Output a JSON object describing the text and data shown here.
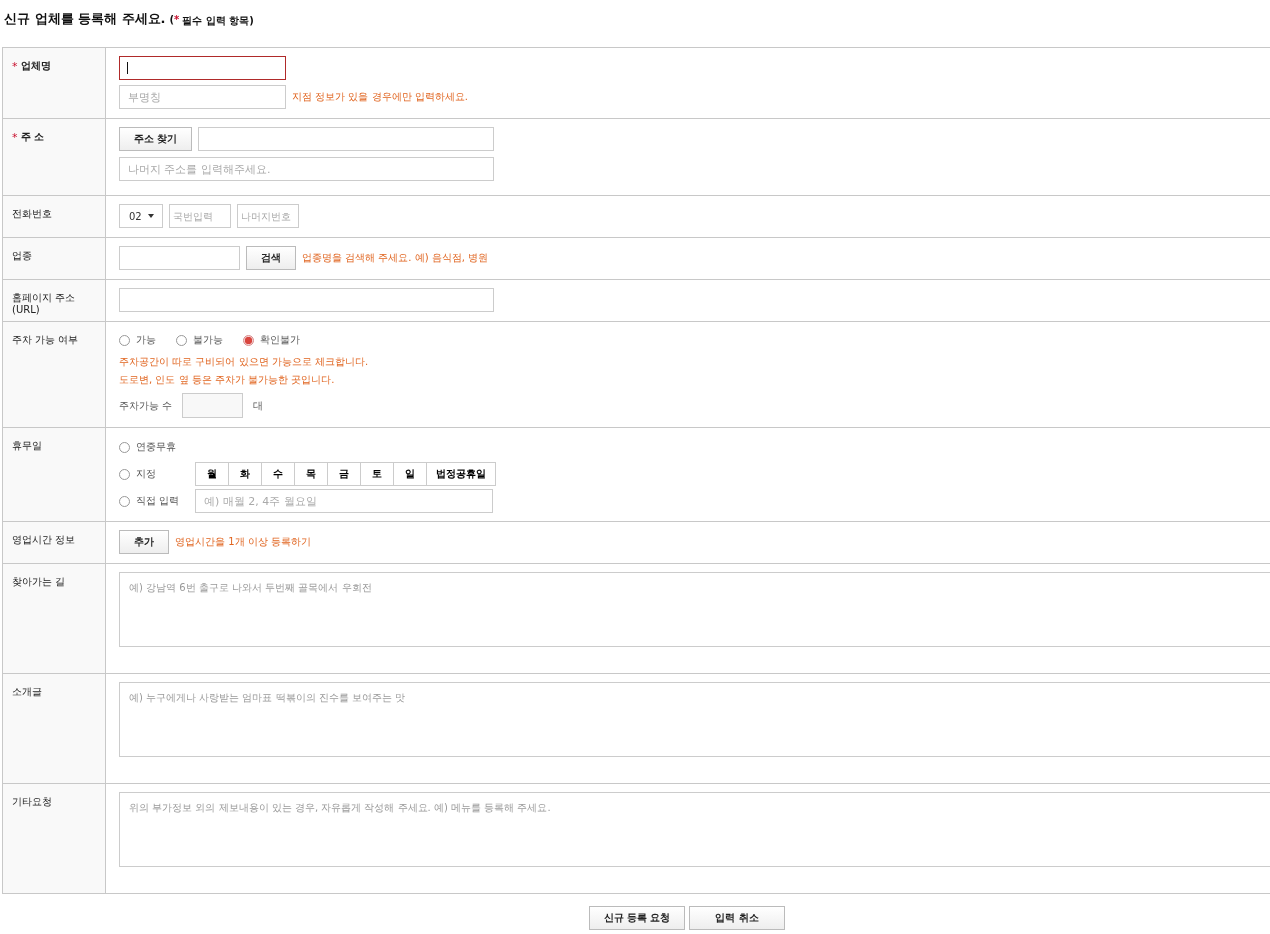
{
  "title": "신규 업체를 등록해 주세요.",
  "required_note": {
    "open": "(",
    "mark": "*",
    "text": "필수 입력 항목)"
  },
  "rows": [
    {
      "kind": "name",
      "label": "업체명",
      "required": true,
      "main": {
        "focused": true
      },
      "sub": {
        "placeholder": "부명칭"
      },
      "hint": "지점 정보가 있을 경우에만 입력하세요."
    },
    {
      "kind": "address",
      "label": "주 소",
      "required": true,
      "button": "주소 찾기",
      "detail": {
        "placeholder": "나머지 주소를 입력해주세요."
      }
    },
    {
      "kind": "phone",
      "label": "전화번호",
      "required": false,
      "area": "02",
      "fields": [
        {
          "placeholder": "국번입력"
        },
        {
          "placeholder": "나머지번호"
        }
      ]
    },
    {
      "kind": "search",
      "label": "업종",
      "required": false,
      "button": "검색",
      "hint": "업종명을 검색해 주세요. 예) 음식점, 병원"
    },
    {
      "kind": "url",
      "label": "홈페이지 주소\n(URL)",
      "required": false
    },
    {
      "kind": "parking",
      "label": "주차 가능 여부",
      "required": false,
      "options": [
        {
          "label": "가능",
          "selected": false
        },
        {
          "label": "불가능",
          "selected": false
        },
        {
          "label": "확인불가",
          "selected": true
        }
      ],
      "hints": [
        "주차공간이 따로 구비되어 있으면 가능으로 체크합니다.",
        "도로변, 인도 옆 등은 주차가 불가능한 곳입니다."
      ],
      "count_label": "주차가능 수",
      "unit": "대"
    },
    {
      "kind": "holiday",
      "label": "휴무일",
      "required": false,
      "options": [
        {
          "kind": "plain",
          "label": "연중무휴",
          "selected": false
        },
        {
          "kind": "days",
          "label": "지정",
          "selected": false,
          "days": [
            "월",
            "화",
            "수",
            "목",
            "금",
            "토",
            "일",
            "법정공휴일"
          ]
        },
        {
          "kind": "input",
          "label": "직접 입력",
          "selected": false,
          "placeholder": "예) 매월 2, 4주 월요일"
        }
      ]
    },
    {
      "kind": "hours",
      "label": "영업시간 정보",
      "required": false,
      "button": "추가",
      "hint": "영업시간을 1개 이상 등록하기"
    },
    {
      "kind": "textarea",
      "label": "찾아가는 길",
      "required": false,
      "placeholder": "예) 강남역 6번 출구로 나와서 두번째 골목에서 우회전"
    },
    {
      "kind": "textarea",
      "label": "소개글",
      "required": false,
      "placeholder": "예) 누구에게나 사랑받는 엄마표 떡볶이의 진수를 보여주는 맛"
    },
    {
      "kind": "textarea",
      "label": "기타요청",
      "required": false,
      "placeholder": "위의 부가정보 외의 제보내용이 있는 경우, 자유롭게 작성해 주세요. 예) 메뉴를 등록해 주세요."
    }
  ],
  "buttons": [
    "신규 등록 요청",
    "입력 취소"
  ]
}
